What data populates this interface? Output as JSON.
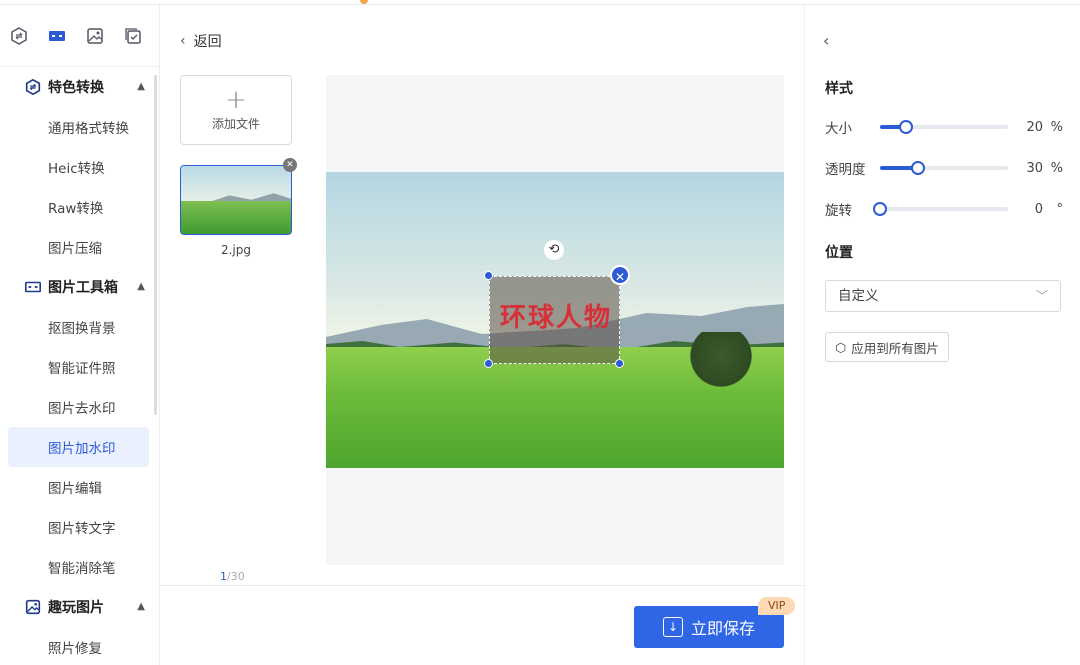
{
  "sidebar": {
    "top_icons": [
      "convert-icon",
      "toolbox-icon",
      "fun-image-icon",
      "checklist-icon"
    ],
    "groups": [
      {
        "title": "特色转换",
        "icon": "convert-icon",
        "items": [
          "通用格式转换",
          "Heic转换",
          "Raw转换",
          "图片压缩"
        ]
      },
      {
        "title": "图片工具箱",
        "icon": "toolbox-icon",
        "items": [
          "抠图换背景",
          "智能证件照",
          "图片去水印",
          "图片加水印",
          "图片编辑",
          "图片转文字",
          "智能消除笔"
        ]
      },
      {
        "title": "趣玩图片",
        "icon": "fun-image-icon",
        "items": [
          "照片修复"
        ]
      }
    ],
    "active_item": "图片加水印"
  },
  "main": {
    "back_label": "返回",
    "add_file_label": "添加文件",
    "thumbnail_name": "2.jpg",
    "counter_current": "1",
    "counter_total": "/30",
    "watermark_text": "环球人物",
    "save_label": "立即保存",
    "vip_label": "VIP"
  },
  "panel": {
    "style_title": "样式",
    "size_label": "大小",
    "size_value": "20",
    "size_unit": "%",
    "size_level": 20,
    "opacity_label": "透明度",
    "opacity_value": "30",
    "opacity_unit": "%",
    "opacity_level": 30,
    "rotate_label": "旋转",
    "rotate_value": "0",
    "rotate_unit": "°",
    "rotate_level": 0,
    "position_title": "位置",
    "position_value": "自定义",
    "apply_all_label": "应用到所有图片"
  },
  "colors": {
    "accent": "#2d5bd6",
    "save_button": "#2e66e6",
    "vip_badge": "#fdd9b5",
    "watermark": "#d6303a"
  }
}
